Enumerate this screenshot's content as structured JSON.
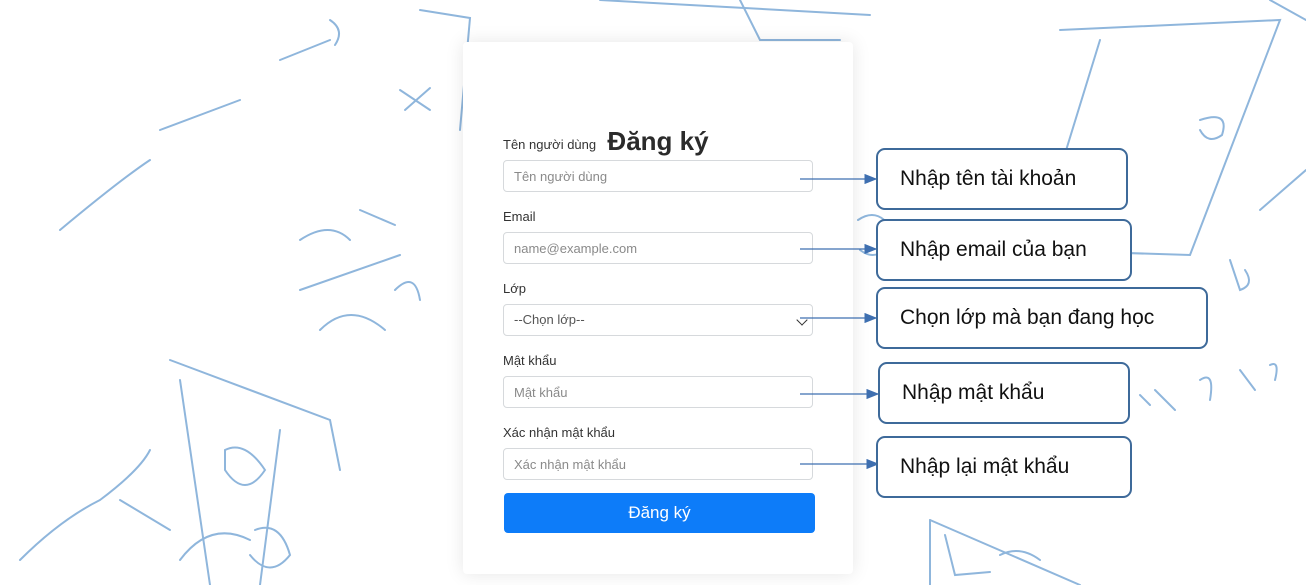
{
  "form": {
    "title": "Đăng ký",
    "username": {
      "label": "Tên người dùng",
      "placeholder": "Tên người dùng"
    },
    "email": {
      "label": "Email",
      "placeholder": "name@example.com"
    },
    "class": {
      "label": "Lớp",
      "selected": "--Chọn lớp--"
    },
    "password": {
      "label": "Mật khẩu",
      "placeholder": "Mật khẩu"
    },
    "confirm": {
      "label": "Xác nhận mật khẩu",
      "placeholder": "Xác nhận mật khẩu"
    },
    "submit_label": "Đăng ký",
    "button_color": "#0d7cf9"
  },
  "annotations": [
    "Nhập tên tài khoản",
    "Nhập email của bạn",
    "Chọn lớp mà bạn đang học",
    "Nhập mật khẩu",
    "Nhập lại mật khẩu"
  ],
  "colors": {
    "callout_border": "#3e6a9a",
    "arrow": "#3e6fb0",
    "doodle": "#8fb6dc"
  }
}
